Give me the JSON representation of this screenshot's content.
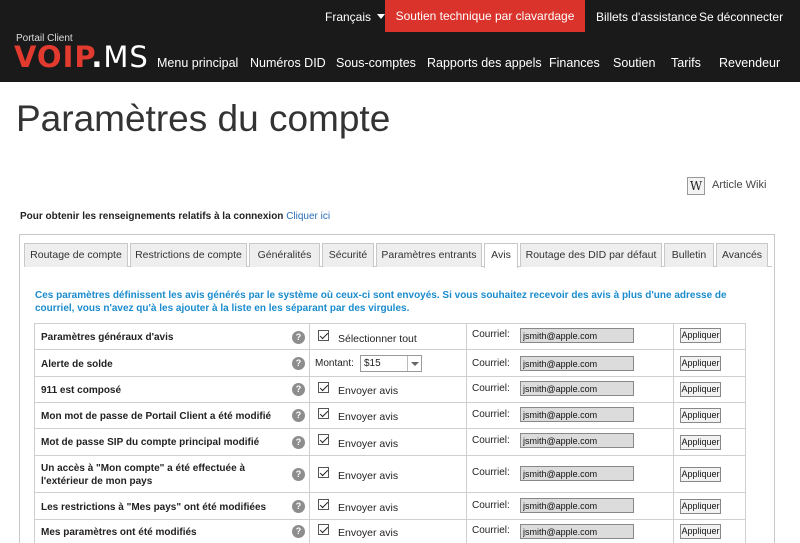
{
  "header": {
    "language": "Français",
    "chat_support": "Soutien technique par clavardage",
    "tickets": "Billets d'assistance",
    "logout": "Se déconnecter",
    "brand_sub": "Portail Client",
    "logo_voip": "VOIP",
    "logo_dot": ".",
    "logo_ms": "MS",
    "nav": [
      "Menu principal",
      "Numéros DID",
      "Sous-comptes",
      "Rapports des appels",
      "Finances",
      "Soutien",
      "Tarifs",
      "Revendeur"
    ]
  },
  "page": {
    "title": "Paramètres du compte",
    "wiki_icon": "W",
    "wiki_label": "Article Wiki",
    "conn_info_text": "Pour obtenir les renseignements relatifs à la connexion",
    "conn_info_link": "Cliquer ici"
  },
  "tabs": [
    "Routage de compte",
    "Restrictions de compte",
    "Généralités",
    "Sécurité",
    "Paramètres entrants",
    "Avis",
    "Routage des DID par défaut",
    "Bulletin",
    "Avancés"
  ],
  "active_tab": "Avis",
  "notice": "Ces paramètres définissent les avis générés par le système où ceux-ci sont envoyés. Si vous souhaitez recevoir des avis à plus d'une adresse de courriel, vous n'avez qu'à les ajouter à la liste en les séparant par des virgules.",
  "common": {
    "help": "?",
    "email_label": "Courriel:",
    "email_value": "jsmith@apple.com",
    "apply": "Appliquer",
    "send_notice": "Envoyer avis",
    "select_all": "Sélectionner tout",
    "amount_label": "Montant:",
    "amount_value": "$15"
  },
  "rows": [
    "Paramètres généraux d'avis",
    "Alerte de solde",
    "911 est composé",
    "Mon mot de passe de Portail Client a été modifié",
    "Mot de passe SIP du compte principal modifié",
    "Un accès à \"Mon compte\" a été effectuée à l'extérieur de mon pays",
    "Les restrictions à \"Mes pays\" ont été modifiées",
    "Mes paramètres ont été modifiés"
  ],
  "colors": {
    "header_bg": "#1a1a1a",
    "accent_red": "#d9332b",
    "notice_blue": "#1a8ccd",
    "link_blue": "#2a6fb5"
  }
}
